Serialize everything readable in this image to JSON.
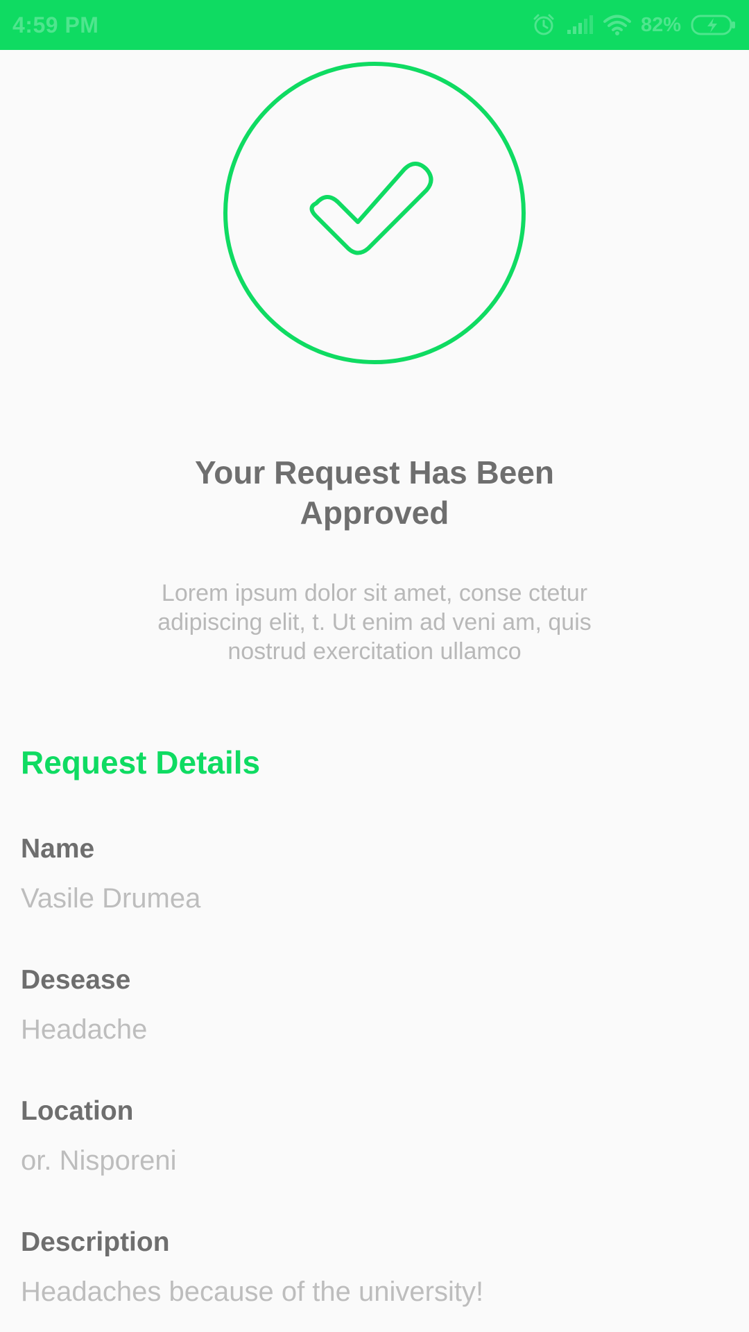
{
  "status_bar": {
    "time": "4:59 PM",
    "battery_percent": "82%",
    "icons": [
      "alarm-icon",
      "signal-icon",
      "wifi-icon",
      "battery-charging-icon"
    ],
    "background_color": "#0fdb62"
  },
  "hero": {
    "icon": "check-circle-icon",
    "accent_color": "#0fdb62"
  },
  "message": {
    "title_line1": "Your Request Has Been",
    "title_line2": "Approved",
    "body_line1": "Lorem ipsum dolor sit amet, conse ctetur",
    "body_line2": "adipiscing elit, t. Ut enim ad veni am, quis",
    "body_line3": "nostrud exercitation ullamco"
  },
  "details": {
    "heading": "Request Details",
    "items": [
      {
        "label": "Name",
        "value": "Vasile Drumea"
      },
      {
        "label": "Desease",
        "value": "Headache"
      },
      {
        "label": "Location",
        "value": "or. Nisporeni"
      },
      {
        "label": "Description",
        "value": "Headaches because of the university!"
      }
    ]
  }
}
